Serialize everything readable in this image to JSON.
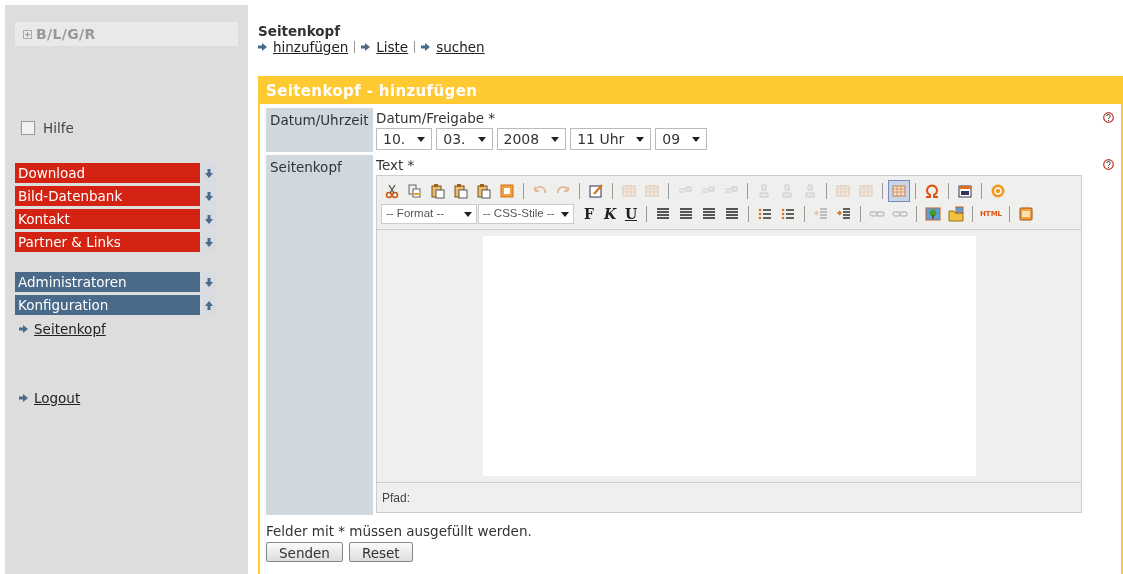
{
  "sidebar": {
    "logo": "B/L/G/R",
    "help": {
      "label": "Hilfe",
      "checked": false
    },
    "groups": [
      {
        "color": "#d42312",
        "items": [
          {
            "label": "Download",
            "expanded": false
          },
          {
            "label": "Bild-Datenbank",
            "expanded": false
          },
          {
            "label": "Kontakt",
            "expanded": false
          },
          {
            "label": "Partner & Links",
            "expanded": false
          }
        ]
      },
      {
        "color": "#4a6a89",
        "items": [
          {
            "label": "Administratoren",
            "expanded": false
          },
          {
            "label": "Konfiguration",
            "expanded": true,
            "children": [
              "Seitenkopf"
            ]
          }
        ]
      }
    ],
    "logout": "Logout"
  },
  "page": {
    "title": "Seitenkopf",
    "links": [
      "hinzufügen",
      "Liste",
      "suchen"
    ]
  },
  "form": {
    "title": "Seitenkopf - hinzufügen",
    "date_row": {
      "label": "Datum/Uhrzeit",
      "field_label": "Datum/Freigabe *",
      "selects": [
        "10.",
        "03.",
        "2008",
        "11 Uhr",
        "09"
      ]
    },
    "text_row": {
      "label": "Seitenkopf",
      "field_label": "Text *",
      "toolbar_1": [
        {
          "kind": "cut",
          "disabled": false,
          "selected": false
        },
        {
          "kind": "copy",
          "disabled": false,
          "selected": false
        },
        {
          "kind": "paste",
          "disabled": false,
          "selected": false
        },
        {
          "kind": "paste-text",
          "disabled": false,
          "selected": false
        },
        {
          "kind": "paste-word",
          "disabled": false,
          "selected": false
        },
        {
          "kind": "select-all",
          "disabled": false,
          "selected": false
        },
        {
          "kind": "sep"
        },
        {
          "kind": "undo",
          "disabled": true,
          "selected": false
        },
        {
          "kind": "redo",
          "disabled": true,
          "selected": false
        },
        {
          "kind": "sep"
        },
        {
          "kind": "edit",
          "disabled": false,
          "selected": false
        },
        {
          "kind": "sep"
        },
        {
          "kind": "table",
          "disabled": true,
          "selected": false
        },
        {
          "kind": "table",
          "disabled": true,
          "selected": false
        },
        {
          "kind": "sep"
        },
        {
          "kind": "row",
          "disabled": true,
          "selected": false
        },
        {
          "kind": "row",
          "disabled": true,
          "selected": false
        },
        {
          "kind": "row",
          "disabled": true,
          "selected": false
        },
        {
          "kind": "sep"
        },
        {
          "kind": "column",
          "disabled": true,
          "selected": false
        },
        {
          "kind": "column",
          "disabled": true,
          "selected": false
        },
        {
          "kind": "column",
          "disabled": true,
          "selected": false
        },
        {
          "kind": "sep"
        },
        {
          "kind": "table",
          "disabled": true,
          "selected": false
        },
        {
          "kind": "table",
          "disabled": true,
          "selected": false
        },
        {
          "kind": "sep"
        },
        {
          "kind": "table",
          "disabled": false,
          "selected": true
        },
        {
          "kind": "sep"
        },
        {
          "kind": "omega",
          "disabled": false,
          "selected": false
        },
        {
          "kind": "sep"
        },
        {
          "kind": "calendar",
          "disabled": false,
          "selected": false
        },
        {
          "kind": "sep"
        },
        {
          "kind": "help",
          "disabled": false,
          "selected": false
        }
      ],
      "format_select": "-- Format --",
      "style_select": "-- CSS-Stile --",
      "toolbar_2": [
        {
          "kind": "bold",
          "text": "F"
        },
        {
          "kind": "italic",
          "text": "K"
        },
        {
          "kind": "underline",
          "text": "U"
        },
        {
          "kind": "sep"
        },
        {
          "kind": "align",
          "disabled": false
        },
        {
          "kind": "align",
          "disabled": false
        },
        {
          "kind": "align",
          "disabled": false
        },
        {
          "kind": "align",
          "disabled": false
        },
        {
          "kind": "sep"
        },
        {
          "kind": "list",
          "disabled": false
        },
        {
          "kind": "list",
          "disabled": false
        },
        {
          "kind": "sep"
        },
        {
          "kind": "outdent",
          "disabled": true
        },
        {
          "kind": "indent",
          "disabled": false
        },
        {
          "kind": "sep"
        },
        {
          "kind": "link",
          "disabled": true
        },
        {
          "kind": "unlink",
          "disabled": true
        },
        {
          "kind": "sep"
        },
        {
          "kind": "image",
          "disabled": false
        },
        {
          "kind": "folder",
          "disabled": false
        },
        {
          "kind": "sep"
        },
        {
          "kind": "html",
          "text": "HTML"
        },
        {
          "kind": "sep"
        },
        {
          "kind": "template",
          "disabled": false
        }
      ],
      "path_label": "Pfad:"
    },
    "note": "Felder mit * müssen ausgefüllt werden.",
    "buttons": [
      "Senden",
      "Reset"
    ]
  }
}
